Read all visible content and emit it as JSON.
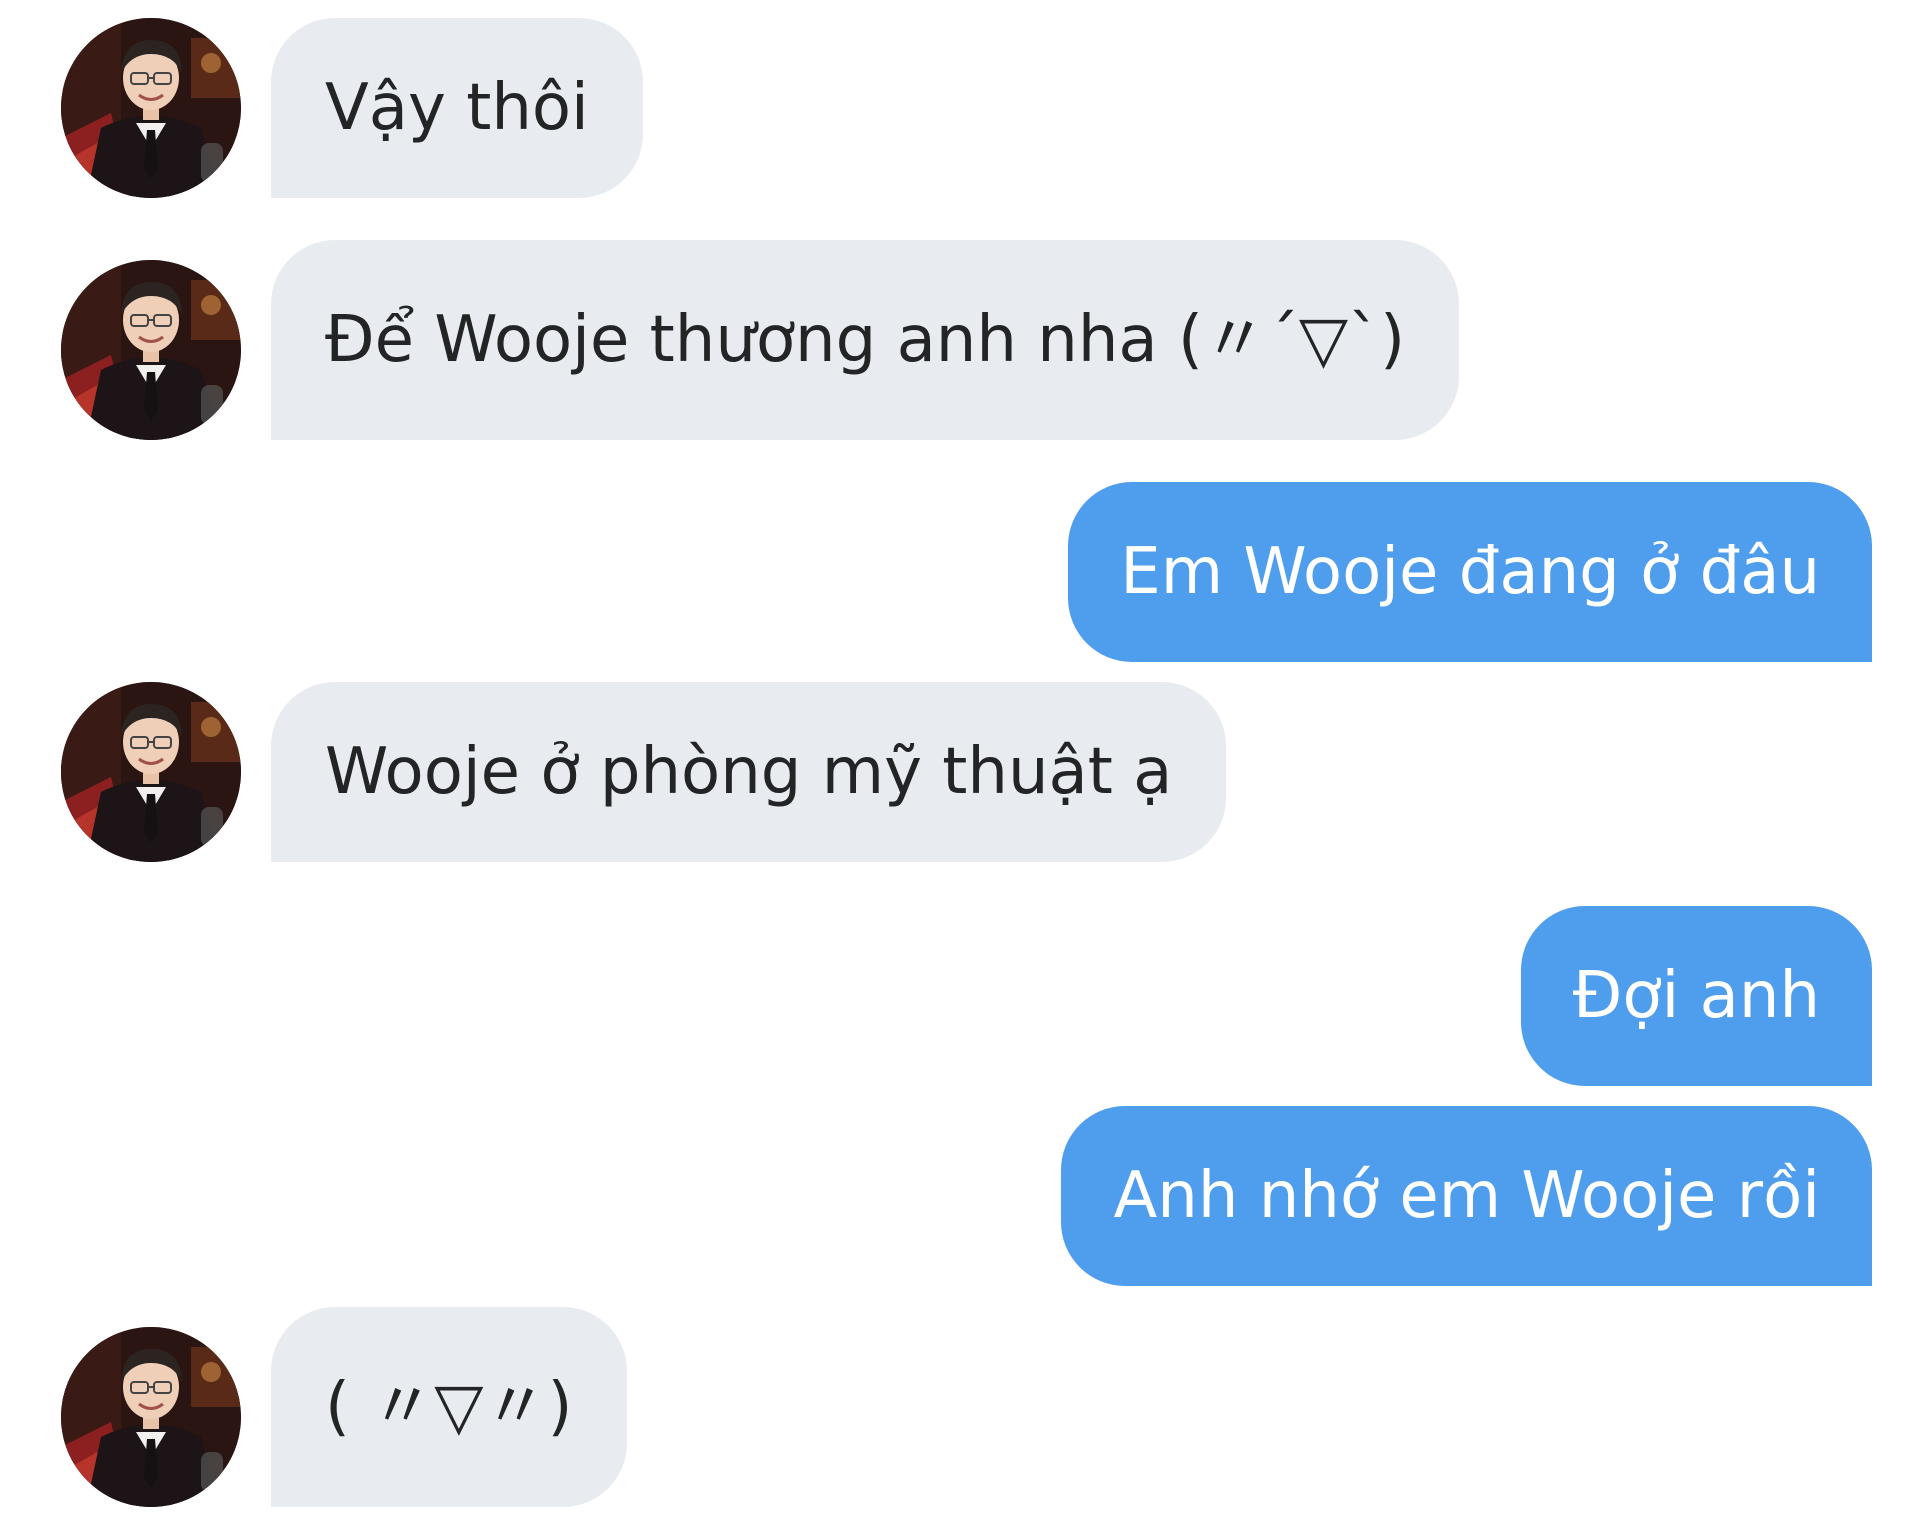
{
  "conversation": {
    "messages": [
      {
        "sender": "contact",
        "text": "Vậy thôi",
        "avatar_icon": "profile-photo-icon"
      },
      {
        "sender": "contact",
        "text": "Để Wooje thương anh nha (〃´▽`)",
        "avatar_icon": "profile-photo-icon"
      },
      {
        "sender": "me",
        "text": "Em Wooje đang ở đâu"
      },
      {
        "sender": "contact",
        "text": "Wooje ở phòng mỹ thuật ạ",
        "avatar_icon": "profile-photo-icon"
      },
      {
        "sender": "me",
        "text": "Đợi anh"
      },
      {
        "sender": "me",
        "text": "Anh nhớ em Wooje rồi"
      },
      {
        "sender": "contact",
        "text": "( 〃▽〃)",
        "avatar_icon": "profile-photo-icon"
      }
    ]
  },
  "colors": {
    "incoming_bubble": "#e8ebf0",
    "outgoing_bubble": "#4f9ded",
    "incoming_text": "#222426",
    "outgoing_text": "#ffffff",
    "background": "#ffffff"
  }
}
